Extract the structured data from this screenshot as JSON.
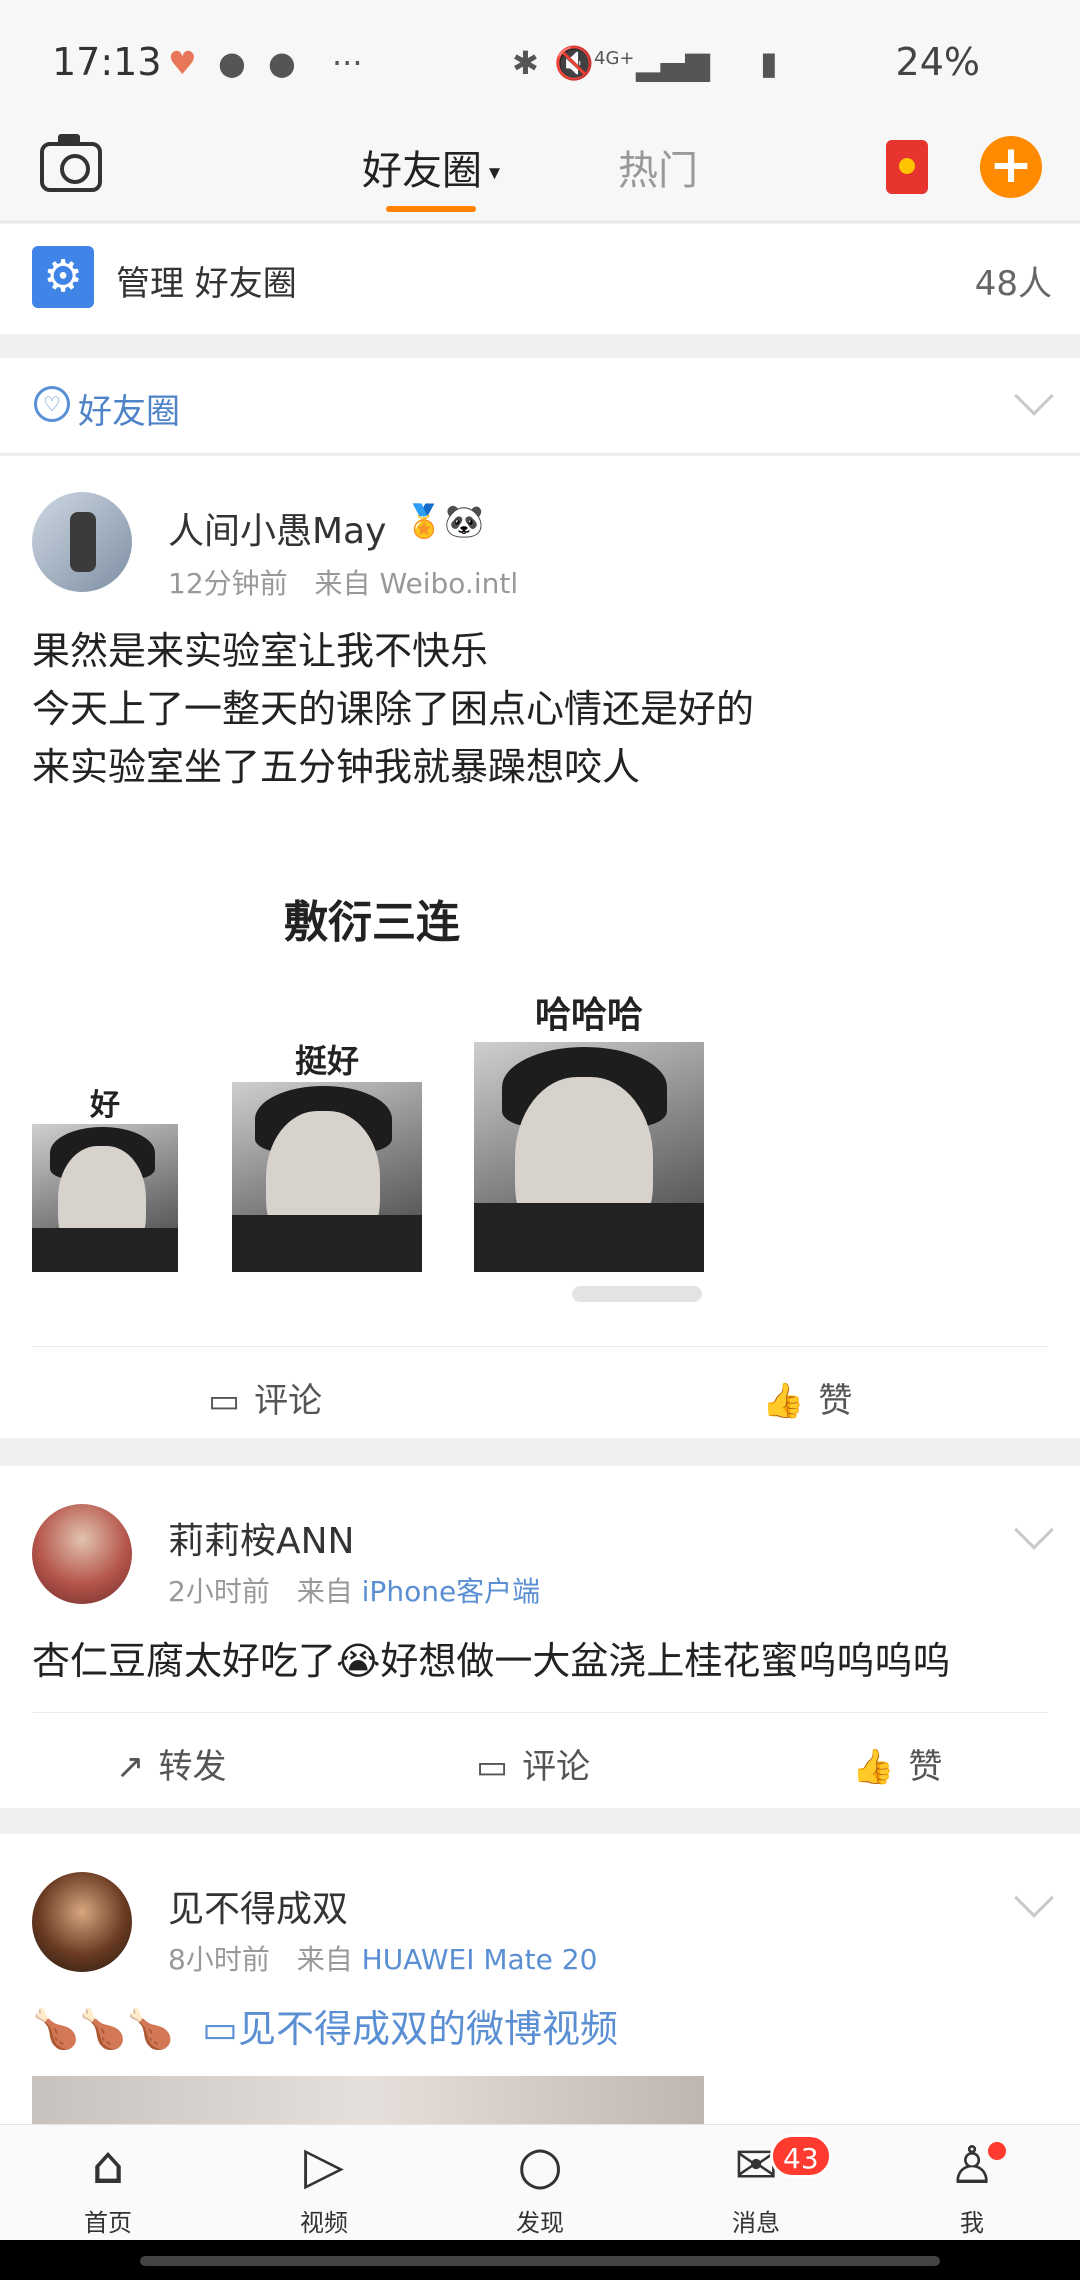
{
  "status_bar": {
    "time": "17:13",
    "battery": "24%",
    "network": "4G+"
  },
  "top_nav": {
    "tab_friends": "好友圈",
    "tab_hot": "热门"
  },
  "manage_bar": {
    "label": "管理 好友圈",
    "count": "48人"
  },
  "filter_bar": {
    "label": "好友圈"
  },
  "posts": [
    {
      "username": "人间小愚May",
      "time": "12分钟前",
      "from_prefix": "来自",
      "source": "Weibo.intl",
      "lines": [
        "果然是来实验室让我不快乐",
        "今天上了一整天的课除了困点心情还是好的",
        "来实验室坐了五分钟我就暴躁想咬人"
      ],
      "meme": {
        "title": "敷衍三连",
        "captions": [
          "好",
          "挺好",
          "哈哈哈"
        ]
      },
      "actions": {
        "comment": "评论",
        "like": "赞"
      }
    },
    {
      "username": "莉莉桉ANN",
      "time": "2小时前",
      "from_prefix": "来自",
      "source": "iPhone客户端",
      "text": "杏仁豆腐太好吃了😭好想做一大盆浇上桂花蜜呜呜呜呜",
      "actions": {
        "repost": "转发",
        "comment": "评论",
        "like": "赞"
      }
    },
    {
      "username": "见不得成双",
      "time": "8小时前",
      "from_prefix": "来自",
      "source": "HUAWEI Mate 20",
      "emoji": "🍗🍗🍗",
      "video_link": "见不得成双的微博视频"
    }
  ],
  "bottom_nav": {
    "home": "首页",
    "video": "视频",
    "discover": "发现",
    "messages": "消息",
    "messages_badge": "43",
    "me": "我"
  },
  "colors": {
    "accent": "#ff8200",
    "link": "#5b8fd3",
    "badge": "#ff3b30"
  }
}
